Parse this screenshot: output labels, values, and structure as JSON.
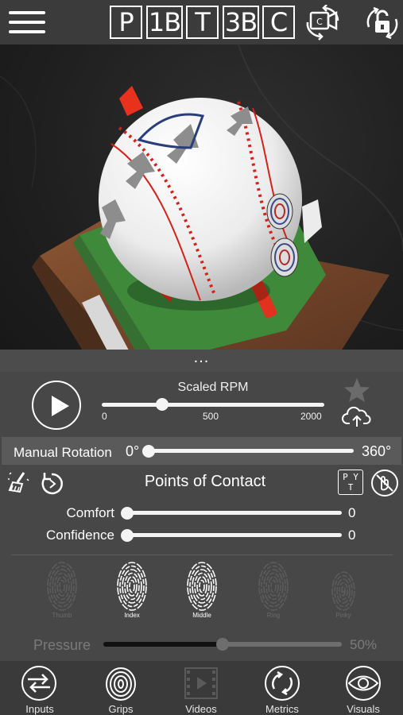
{
  "topbar": {
    "menu_icon": "hamburger-menu-icon",
    "positions": [
      "P",
      "1B",
      "T",
      "3B",
      "C"
    ],
    "camera_icon": "camera-rotate-icon",
    "lock_icon": "rotate-lock-icon"
  },
  "viewport": {
    "scene": "3d-baseball-on-mound",
    "handle_text": "..."
  },
  "controls": {
    "play_icon": "play-icon",
    "rpm": {
      "label": "Scaled RPM",
      "ticks": [
        "0",
        "500",
        "2000"
      ],
      "value_fraction": 0.27
    },
    "favorite_icon": "star-icon",
    "upload_icon": "cloud-upload-icon",
    "manual_rotation": {
      "label": "Manual Rotation",
      "min_label": "0°",
      "max_label": "360°",
      "value_fraction": 0
    },
    "points_of_contact": {
      "title": "Points of Contact",
      "clear_icon": "broom-clear-icon",
      "reset_icon": "reset-rotate-icon",
      "pyt_label": "P Y\nT",
      "gesture_icon": "no-touch-icon"
    },
    "comfort": {
      "label": "Comfort",
      "value": "0"
    },
    "confidence": {
      "label": "Confidence",
      "value": "0"
    },
    "fingers": [
      {
        "name": "Thumb",
        "active": false
      },
      {
        "name": "Index",
        "active": true
      },
      {
        "name": "Middle",
        "active": true
      },
      {
        "name": "Ring",
        "active": false
      },
      {
        "name": "Pinky",
        "active": false
      }
    ],
    "pressure": {
      "label": "Pressure",
      "value": "50%",
      "value_fraction": 0.5
    }
  },
  "nav": [
    {
      "label": "Inputs",
      "icon": "inputs-icon"
    },
    {
      "label": "Grips",
      "icon": "fingerprint-icon"
    },
    {
      "label": "Videos",
      "icon": "video-film-icon"
    },
    {
      "label": "Metrics",
      "icon": "metrics-cycle-icon"
    },
    {
      "label": "Visuals",
      "icon": "eye-icon"
    }
  ],
  "colors": {
    "accent_red": "#e8321e",
    "grass": "#3e8a3a",
    "dirt": "#7a4a2a",
    "panel": "#474747"
  }
}
